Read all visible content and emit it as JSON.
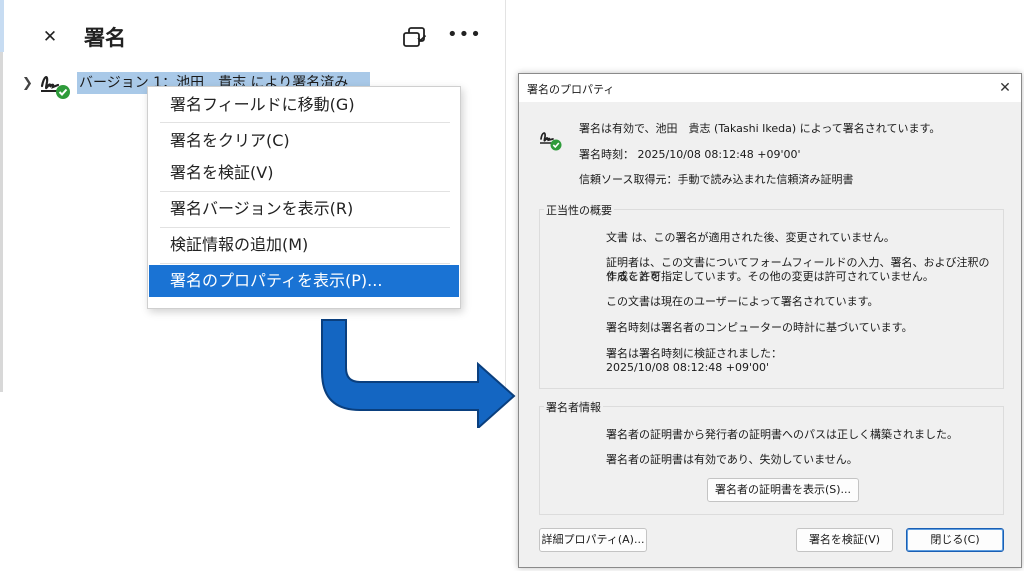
{
  "panel": {
    "title": "署名",
    "close_icon": "close-icon",
    "compare_icon": "compare-versions-icon",
    "more_icon": "more-options-icon",
    "version_label": "バージョン 1：池田　貴志 により署名済み"
  },
  "context_menu": {
    "items": [
      {
        "label": "署名フィールドに移動(G)"
      },
      {
        "label": "署名をクリア(C)"
      },
      {
        "label": "署名を検証(V)"
      },
      {
        "label": "署名バージョンを表示(R)"
      },
      {
        "label": "検証情報の追加(M)"
      },
      {
        "label": "署名のプロパティを表示(P)..."
      }
    ],
    "selected_index": 5
  },
  "dialog": {
    "title": "署名のプロパティ",
    "summary": {
      "status": "署名は有効で、池田　貴志 (Takashi Ikeda) によって署名されています。",
      "time": "署名時刻： 2025/10/08 08:12:48 +09'00'",
      "trust_source": "信頼ソース取得元：手動で読み込まれた信頼済み証明書"
    },
    "validity": {
      "legend": "正当性の概要",
      "line1": "文書 は、この署名が適用された後、変更されていません。",
      "line2a": "証明者は、この文書についてフォームフィールドの入力、署名、および注釈の作成を許可",
      "line2b": "することを指定しています。その他の変更は許可されていません。",
      "line3": "この文書は現在のユーザーによって署名されています。",
      "line4": "署名時刻は署名者のコンピューターの時計に基づいています。",
      "line5a": "署名は署名時刻に検証されました：",
      "line5b": "2025/10/08 08:12:48 +09'00'"
    },
    "signer": {
      "legend": "署名者情報",
      "line1": "署名者の証明書から発行者の証明書へのパスは正しく構築されました。",
      "line2": "署名者の証明書は有効であり、失効していません。",
      "show_cert_button": "署名者の証明書を表示(S)..."
    },
    "buttons": {
      "advanced": "詳細プロパティ(A)...",
      "validate": "署名を検証(V)",
      "close": "閉じる(C)"
    }
  },
  "colors": {
    "selection": "#1a73d4",
    "version_highlight": "#a9c9e8",
    "arrow_fill": "#1466c2",
    "valid_check": "#2e9b3a"
  }
}
